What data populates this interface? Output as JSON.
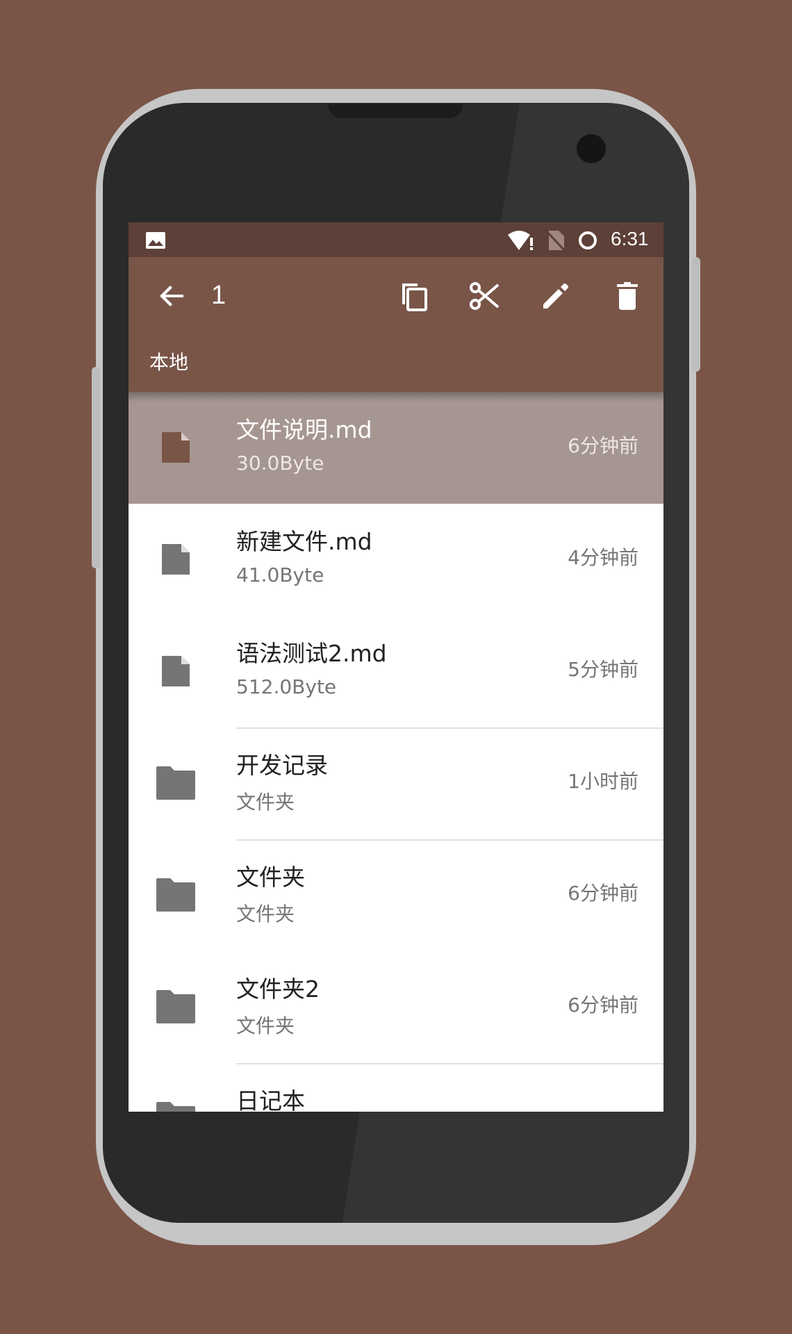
{
  "colors": {
    "background": "#7a5547",
    "status_bar": "#5d4037",
    "toolbar": "#795548",
    "selected_row": "#a69691",
    "selected_file_icon": "#795548",
    "icon_gray": "#757575"
  },
  "status_bar": {
    "time": "6:31",
    "icons": [
      "image-icon",
      "wifi-icon",
      "no-sim-icon",
      "ring-icon"
    ]
  },
  "toolbar": {
    "selection_count": "1",
    "actions": [
      "back-icon",
      "copy-icon",
      "cut-icon",
      "edit-icon",
      "delete-icon"
    ]
  },
  "path": {
    "label": "本地"
  },
  "files": [
    {
      "name": "文件说明.md",
      "sub": "30.0Byte",
      "time": "6分钟前",
      "kind": "file",
      "selected": true
    },
    {
      "name": "新建文件.md",
      "sub": "41.0Byte",
      "time": "4分钟前",
      "kind": "file",
      "selected": false
    },
    {
      "name": "语法测试2.md",
      "sub": "512.0Byte",
      "time": "5分钟前",
      "kind": "file",
      "selected": false
    },
    {
      "name": "开发记录",
      "sub": "文件夹",
      "time": "1小时前",
      "kind": "folder",
      "selected": false
    },
    {
      "name": "文件夹",
      "sub": "文件夹",
      "time": "6分钟前",
      "kind": "folder",
      "selected": false
    },
    {
      "name": "文件夹2",
      "sub": "文件夹",
      "time": "6分钟前",
      "kind": "folder",
      "selected": false
    },
    {
      "name": "日记本",
      "sub": "",
      "time": "",
      "kind": "folder",
      "selected": false
    }
  ]
}
